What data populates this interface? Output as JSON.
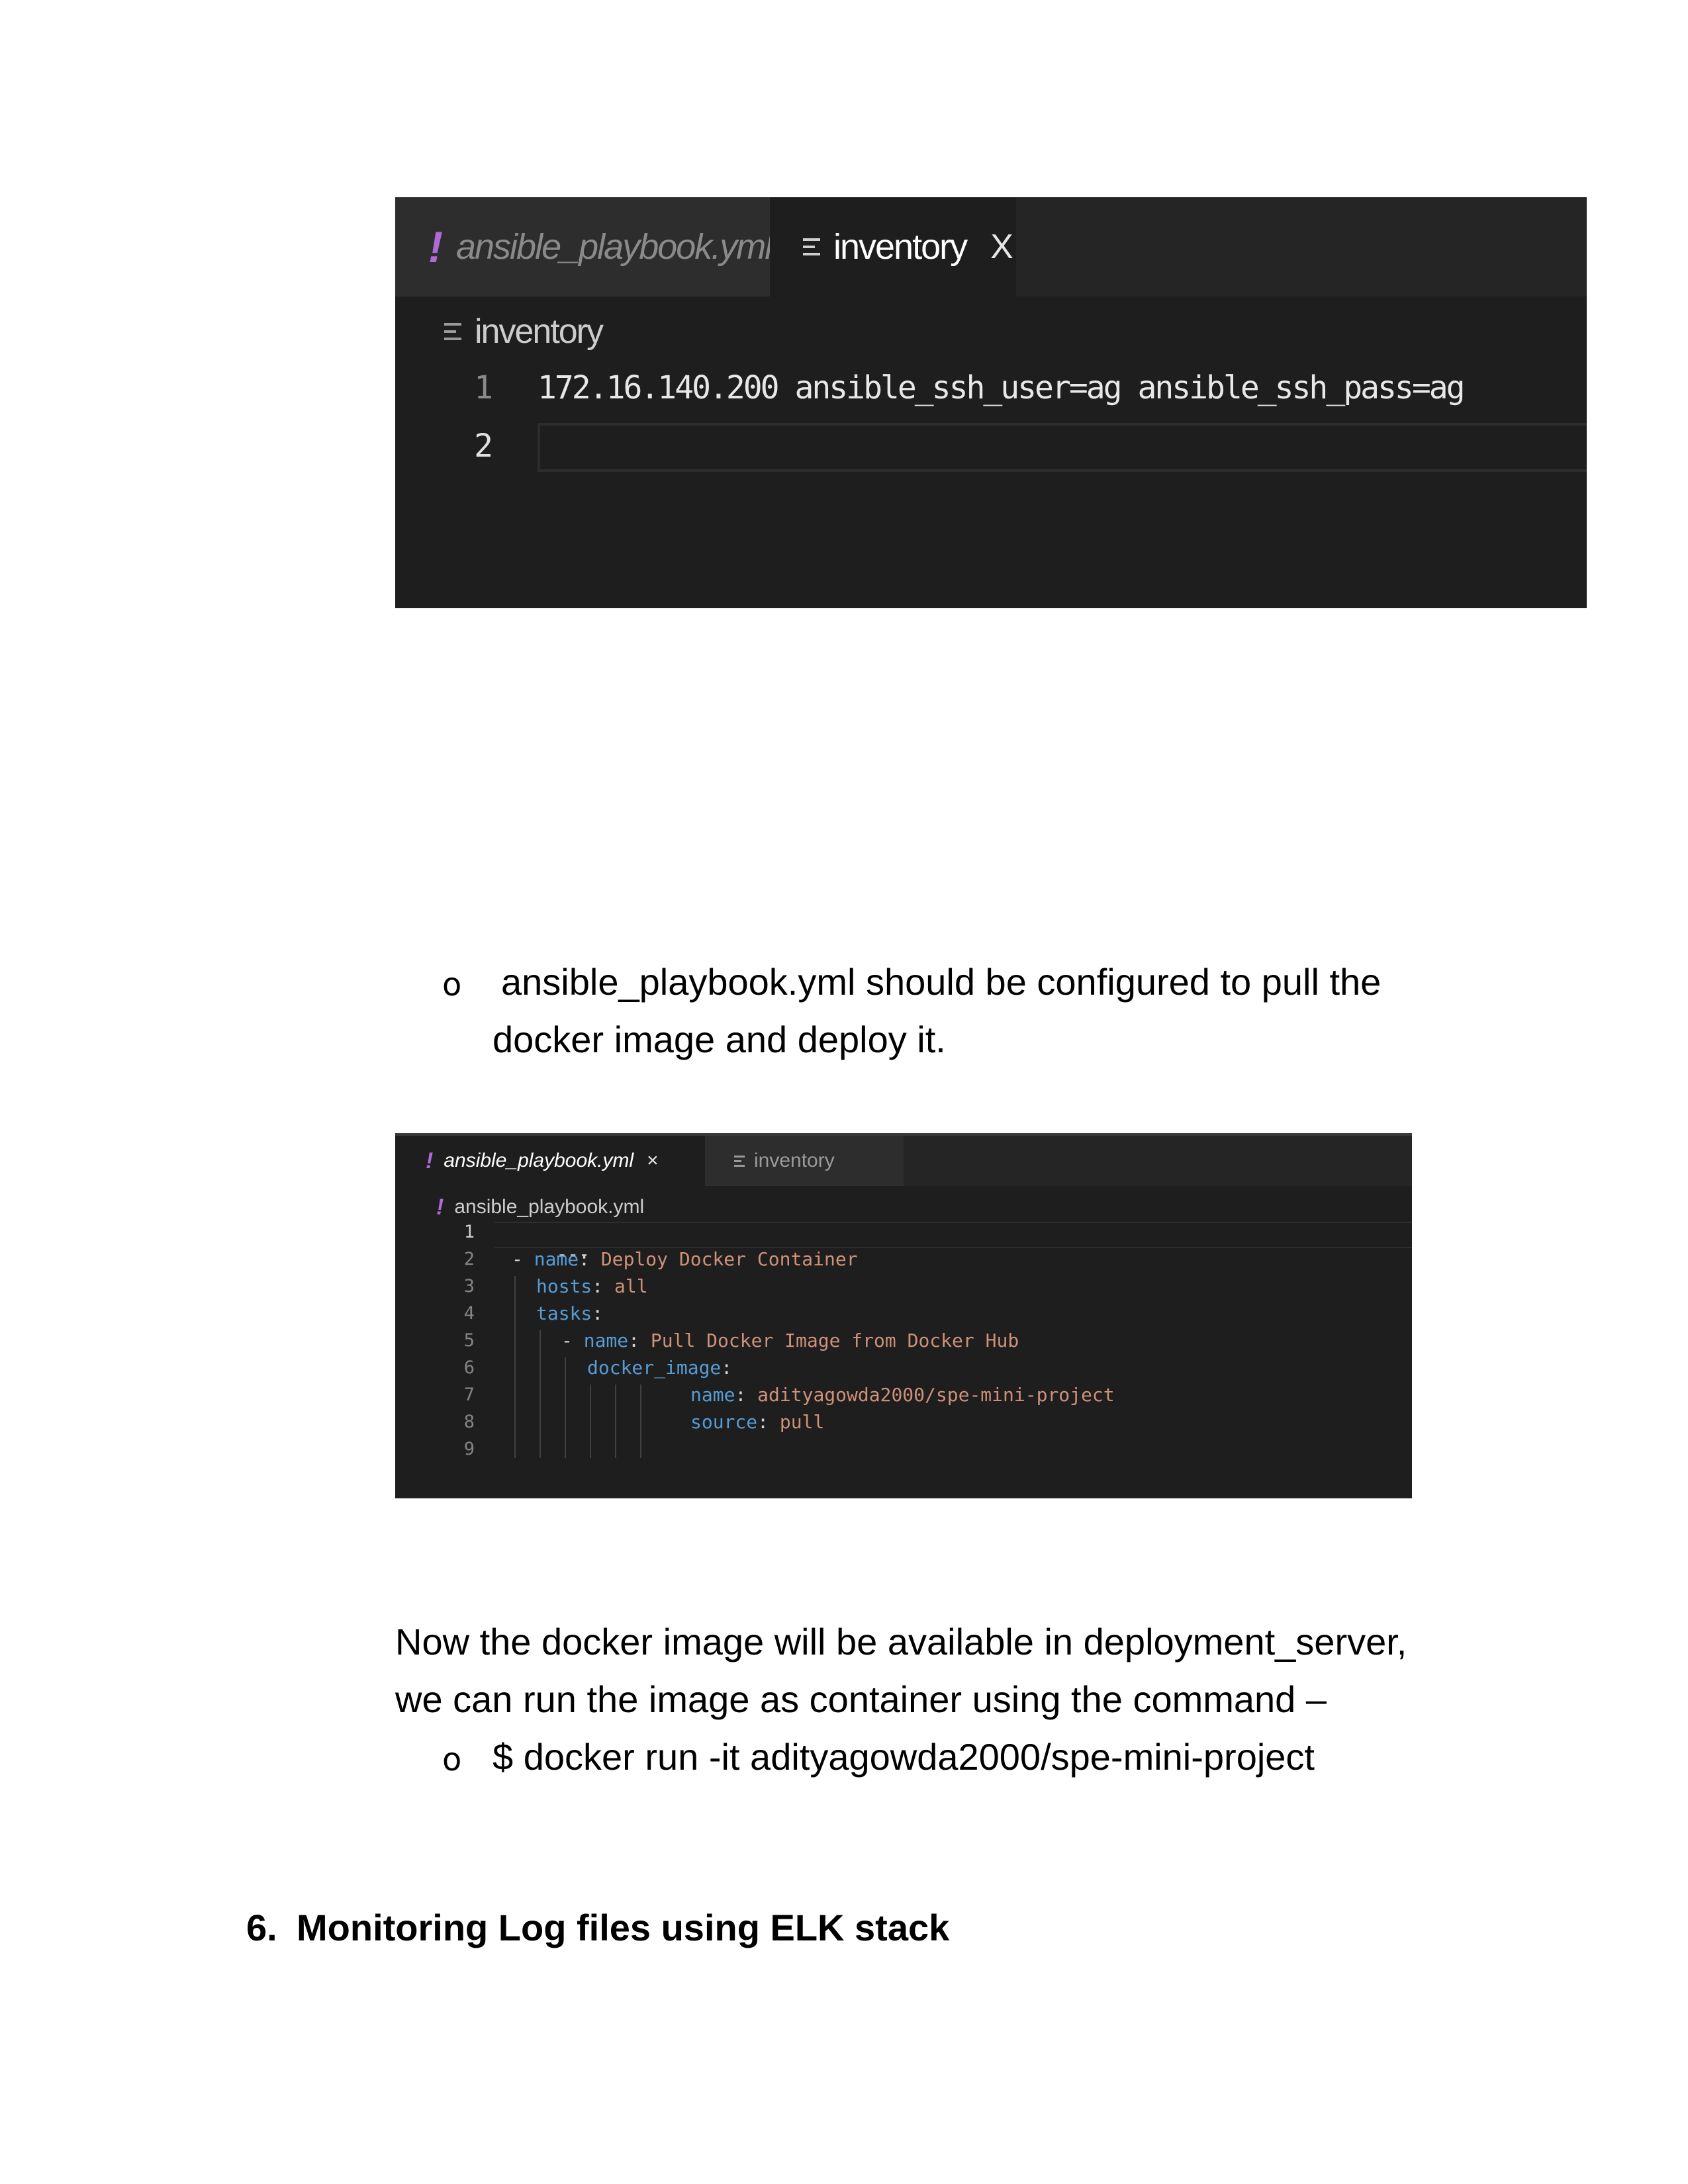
{
  "screenshot_inventory": {
    "tabs": [
      {
        "label": "ansible_playbook.yml",
        "icon": "yaml-exclamation-icon"
      },
      {
        "label": "inventory",
        "icon": "text-lines-icon",
        "active": true,
        "close": "X"
      }
    ],
    "breadcrumb": "inventory",
    "lines": [
      {
        "number": "1",
        "text": "172.16.140.200 ansible_ssh_user=ag ansible_ssh_pass=ag"
      },
      {
        "number": "2",
        "text": ""
      }
    ]
  },
  "bullet_playbook": {
    "marker": "o",
    "text_line1": "ansible_playbook.yml  should be configured to pull the",
    "text_line2": "docker image and deploy it."
  },
  "screenshot_playbook": {
    "tabs": [
      {
        "label": "ansible_playbook.yml",
        "icon": "yaml-exclamation-icon",
        "active": true,
        "close": "×"
      },
      {
        "label": "inventory",
        "icon": "text-lines-icon"
      }
    ],
    "breadcrumb": "ansible_playbook.yml",
    "line_numbers": [
      "1",
      "2",
      "3",
      "4",
      "5",
      "6",
      "7",
      "8",
      "9"
    ],
    "code": {
      "l1": "---",
      "l2_dash": "- ",
      "l2_key": "name",
      "l2_val": "Deploy Docker Container",
      "l3_key": "hosts",
      "l3_val": "all",
      "l4_key": "tasks",
      "l5_dash": "- ",
      "l5_key": "name",
      "l5_val": "Pull Docker Image from Docker Hub",
      "l6_key": "docker_image",
      "l7_key": "name",
      "l7_val": "adityagowda2000/spe-mini-project",
      "l8_key": "source",
      "l8_val": "pull",
      "colon": ": ",
      "colon_end": ":"
    },
    "colors": {
      "key": "#569cd6",
      "value": "#ce9178",
      "background": "#1e1e1e"
    }
  },
  "paragraph": {
    "line1": "Now the docker image will be available in deployment_server,",
    "line2": "we can run the image as container using the command –"
  },
  "bullet_command": {
    "marker": "o",
    "text": "$ docker run -it adityagowda2000/spe-mini-project"
  },
  "section_heading": {
    "number": "6.",
    "title": "Monitoring Log files using ELK stack"
  }
}
